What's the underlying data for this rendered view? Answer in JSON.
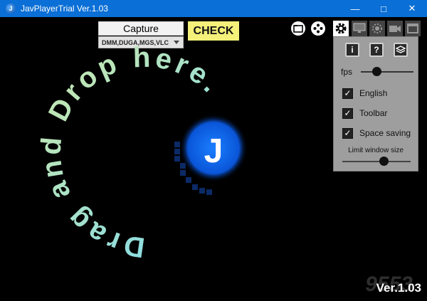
{
  "window": {
    "title": "JavPlayerTrial Ver.1.03",
    "min_glyph": "—",
    "max_glyph": "□",
    "close_glyph": "✕"
  },
  "toolbar": {
    "capture_label": "Capture",
    "check_label": "CHECK",
    "site_select_value": "DMM,DUGA,MGS,VLC",
    "icons": [
      "folder-icon",
      "gamepad-icon",
      "gear-icon",
      "monitor-icon",
      "brightness-icon",
      "camera-icon",
      "window-icon"
    ]
  },
  "settings": {
    "fps_label": "fps",
    "fps_level": 0.3,
    "options": [
      {
        "label": "English",
        "checked": true
      },
      {
        "label": "Toolbar",
        "checked": true
      },
      {
        "label": "Space saving",
        "checked": true
      }
    ],
    "limit_label": "Limit window size",
    "limit_level": 0.6
  },
  "main": {
    "drop_text": "Drag and Drop here.",
    "logo_letter": "J",
    "version": "Ver.1.03"
  },
  "watermark": "9553",
  "colors": {
    "titlebar": "#0a6fd6",
    "check_button": "#f4f07a",
    "logo_blue": "#1a7fff",
    "text_gradient_start": "#cfe9a8",
    "text_gradient_end": "#7ad9f0"
  }
}
